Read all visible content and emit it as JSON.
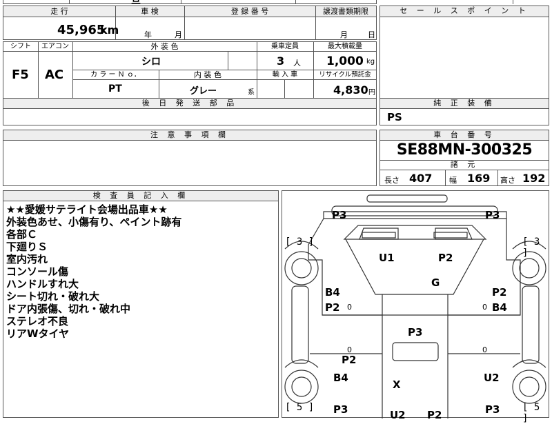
{
  "top_partial": {
    "title_fragment": "旦",
    "small_fragment": "..."
  },
  "mileage_block": {
    "label_mileage": "走 行",
    "label_inspection": "車 検",
    "label_registration": "登 録 番 号",
    "label_transfer_deadline": "譲渡書類期限",
    "mileage_value": "45,965",
    "mileage_unit": "km",
    "inspection_year_unit": "年",
    "inspection_month_unit": "月",
    "transfer_month_unit": "月",
    "transfer_day_unit": "日"
  },
  "specs": {
    "label_shift": "シフト",
    "label_aircon": "エアコン",
    "label_exterior_color": "外 装 色",
    "label_capacity": "乗車定員",
    "label_max_load": "最大積載量",
    "shift_value": "F5",
    "aircon_value": "AC",
    "exterior_color_value": "シロ",
    "capacity_value": "3",
    "capacity_unit": "人",
    "max_load_value": "1,000",
    "max_load_unit": "kg",
    "label_color_no": "カ ラ ー Ｎ ｏ．",
    "label_interior_color": "内 装 色",
    "label_import": "輸 入 車",
    "label_recycle": "リサイクル預託金",
    "color_no_value": "PT",
    "interior_color_value": "グレー",
    "interior_color_suffix": "系",
    "recycle_value": "4,830",
    "recycle_unit": "円",
    "label_later_parts": "後 日 発 送 部 品"
  },
  "sales_point": {
    "label": "セ ー ル ス ポ イ ン ト"
  },
  "equipment": {
    "label": "純 正 装 備",
    "value": "PS"
  },
  "caution": {
    "label": "注 意 事 項 欄"
  },
  "chassis": {
    "label": "車 台 番 号",
    "value": "SE88MN-300325",
    "label_specs": "諸 元",
    "length_label": "長さ",
    "length_value": "407",
    "width_label": "幅",
    "width_value": "169",
    "height_label": "高さ",
    "height_value": "192"
  },
  "inspector": {
    "label": "検 査 員 記 入 欄",
    "notes": [
      "★★愛媛サテライト会場出品車★★",
      "外装色あせ、小傷有り、ペイント跡有",
      "各部Ｃ",
      "下廻りＳ",
      "室内汚れ",
      "コンソール傷",
      "ハンドルすれ大",
      "シート切れ・破れ大",
      "ドア内張傷、切れ・破れ中",
      "ステレオ不良",
      "リアWタイヤ"
    ]
  },
  "diagram": {
    "labels": {
      "p3_tl": "P3",
      "p3_tr": "P3",
      "b3_l": "[ 3 ]",
      "b3_r": "[ 3 ]",
      "u1": "U1",
      "p2_front": "P2",
      "g": "G",
      "b4_l": "B4",
      "p2_l": "P2",
      "o_l": "0",
      "p2_r": "P2",
      "b4_r": "B4",
      "o_r": "0",
      "p3_mid": "P3",
      "o_l2": "0",
      "o_r2": "0",
      "p2_lower": "P2",
      "b4_l2": "B4",
      "u2_r": "U2",
      "x": "X",
      "b5_l": "[ 5 ]",
      "b5_r": "[ 5 ]",
      "p3_bl": "P3",
      "u2_b": "U2",
      "p2_b": "P2",
      "p3_br": "P3"
    }
  }
}
